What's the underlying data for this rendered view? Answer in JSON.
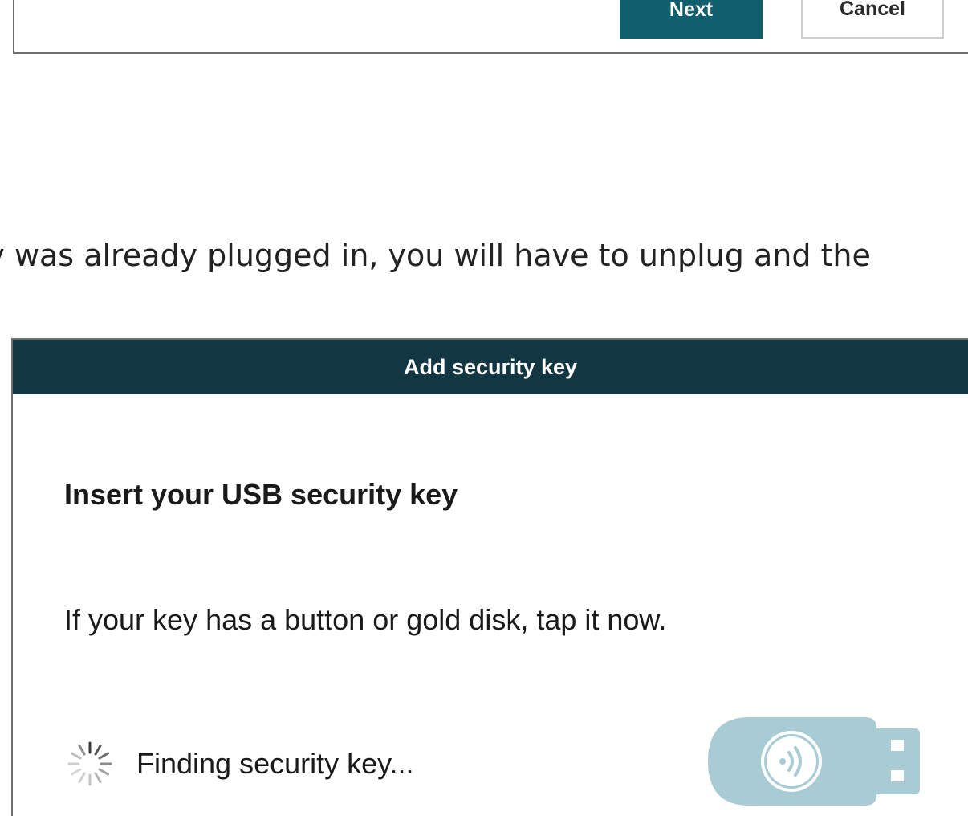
{
  "top_dialog": {
    "next_label": "Next",
    "cancel_label": "Cancel"
  },
  "instruction": {
    "text": "ey was already plugged in, you will have to unplug and the"
  },
  "security_dialog": {
    "title": "Add security key",
    "heading": "Insert your USB security key",
    "hint": "If your key has a button or gold disk, tap it now.",
    "status": "Finding security key...",
    "spinner_icon": "loading-spinner-icon",
    "illustration_icon": "usb-security-key-icon"
  },
  "colors": {
    "titlebar_bg": "#123642",
    "next_button_bg": "#0f5f6e",
    "usb_key_fill": "#a9cbd4"
  }
}
